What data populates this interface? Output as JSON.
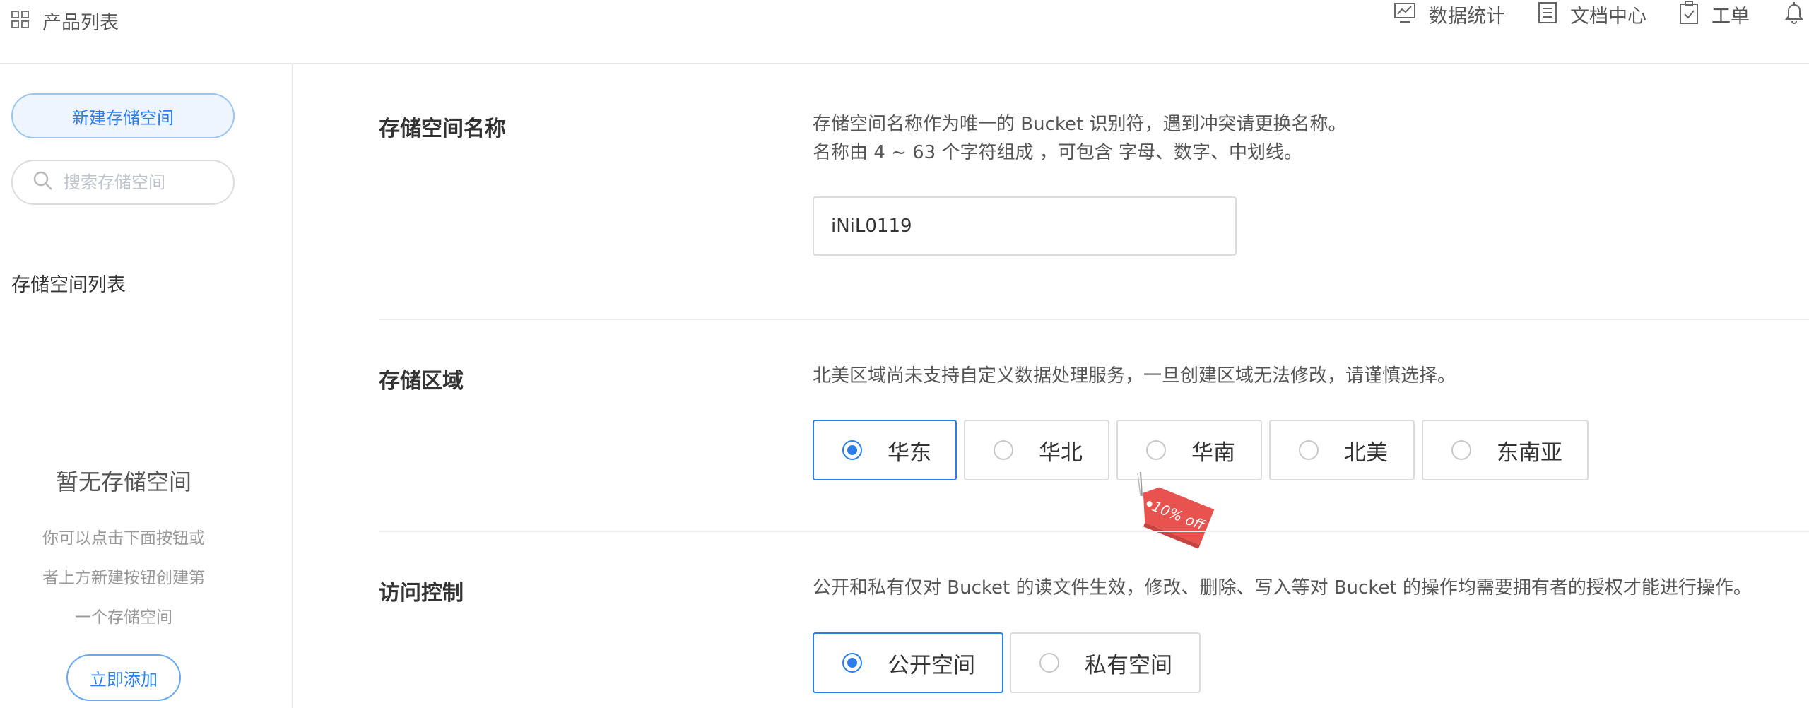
{
  "topbar": {
    "product_list": "产品列表",
    "nav": [
      {
        "label": "数据统计",
        "icon": "chart-icon"
      },
      {
        "label": "文档中心",
        "icon": "document-icon"
      },
      {
        "label": "工单",
        "icon": "clipboard-icon"
      }
    ],
    "bell_icon": "bell-icon"
  },
  "sidebar": {
    "new_button": "新建存储空间",
    "search_placeholder": "搜索存储空间",
    "list_title": "存储空间列表",
    "empty_title": "暂无存储空间",
    "empty_desc": [
      "你可以点击下面按钮或",
      "者上方新建按钮创建第",
      "一个存储空间"
    ],
    "add_button": "立即添加"
  },
  "form": {
    "name": {
      "label": "存储空间名称",
      "desc_line1": "存储空间名称作为唯一的 Bucket 识别符，遇到冲突请更换名称。",
      "desc_line2": "名称由 4 ~ 63 个字符组成 ，可包含 字母、数字、中划线。",
      "value": "iNiL0119"
    },
    "region": {
      "label": "存储区域",
      "desc": "北美区域尚未支持自定义数据处理服务，一旦创建区域无法修改，请谨慎选择。",
      "options": [
        "华东",
        "华北",
        "华南",
        "北美",
        "东南亚"
      ],
      "selected": "华东",
      "promo_tag": "10% off"
    },
    "access": {
      "label": "访问控制",
      "desc": "公开和私有仅对 Bucket 的读文件生效，修改、删除、写入等对 Bucket 的操作均需要拥有者的授权才能进行操作。",
      "options": [
        "公开空间",
        "私有空间"
      ],
      "selected": "公开空间"
    }
  },
  "colors": {
    "accent": "#2b7de9",
    "promo": "#e8534f"
  }
}
